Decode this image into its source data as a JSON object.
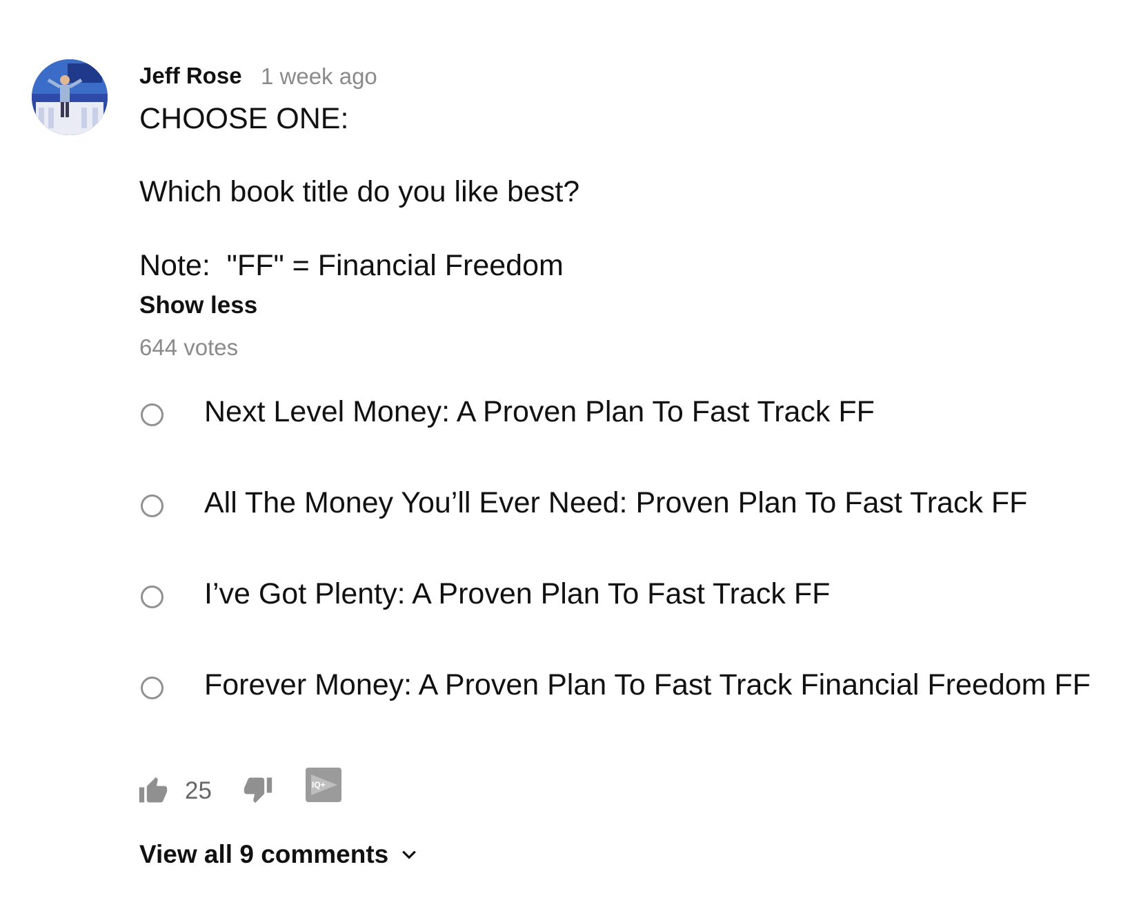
{
  "post": {
    "author": "Jeff Rose",
    "time": "1 week ago",
    "body_lines": [
      "CHOOSE ONE:",
      "Which book title do you like best?",
      "Note:  \"FF\" = Financial Freedom"
    ],
    "show_less_label": "Show less",
    "votes_label": "644 votes"
  },
  "poll": {
    "options": [
      "Next Level Money: A Proven Plan To Fast Track FF",
      "All The Money You’ll Ever Need: Proven Plan To Fast Track FF",
      "I’ve Got Plenty: A Proven Plan To Fast Track FF",
      "Forever Money: A Proven Plan To Fast Track Financial Freedom FF"
    ]
  },
  "actions": {
    "like_count": "25",
    "ext_badge_text": "IQ+",
    "view_all_label": "View all 9 comments"
  },
  "icons": {
    "like": "thumbs-up-icon",
    "dislike": "thumbs-down-icon",
    "extension": "tubebuddy-iq-icon",
    "expand": "chevron-down-icon"
  },
  "colors": {
    "text": "#111111",
    "secondary_text": "#8a8a8a",
    "icon_gray": "#909090",
    "badge_gray": "#9b9b9b"
  }
}
